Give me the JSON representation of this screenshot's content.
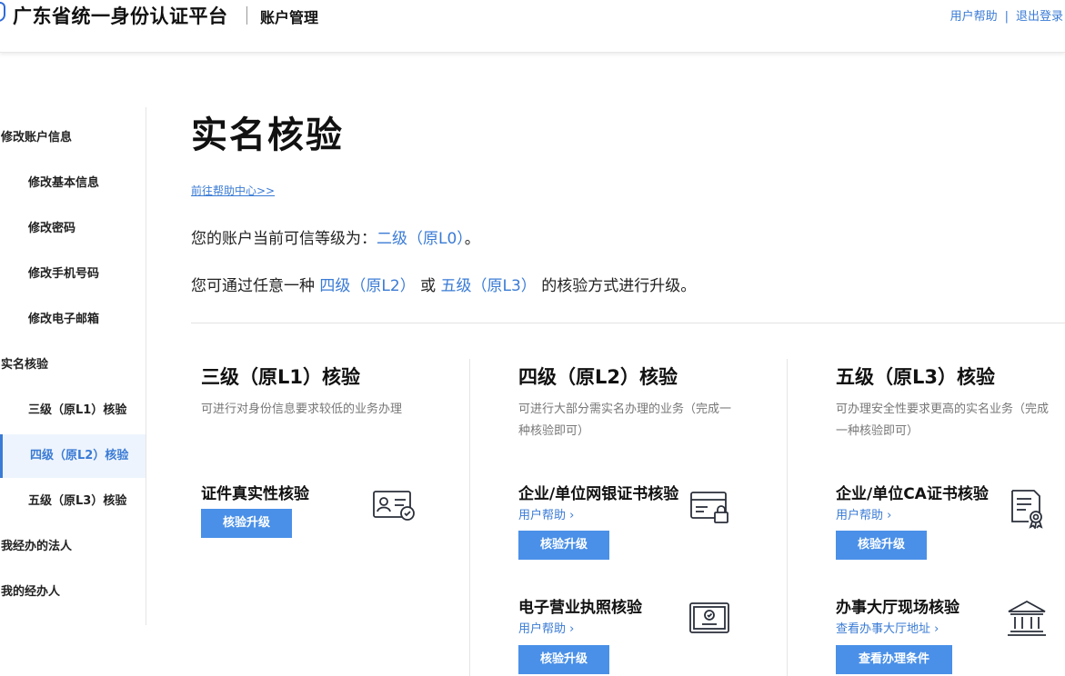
{
  "header": {
    "site_title": "广东省统一身份认证平台",
    "section_title": "账户管理",
    "help_link": "用户帮助",
    "separator": "|",
    "logout_link": "退出登录"
  },
  "sidebar": {
    "items": [
      {
        "label": "修改账户信息"
      },
      {
        "label": "修改基本信息"
      },
      {
        "label": "修改密码"
      },
      {
        "label": "修改手机号码"
      },
      {
        "label": "修改电子邮箱"
      },
      {
        "label": "实名核验"
      },
      {
        "label": "三级（原L1）核验"
      },
      {
        "label": "四级（原L2）核验"
      },
      {
        "label": "五级（原L3）核验"
      },
      {
        "label": "我经办的法人"
      },
      {
        "label": "我的经办人"
      }
    ]
  },
  "main": {
    "title": "实名核验",
    "help_center_link": "前往帮助中心>>",
    "level_prefix": "您的账户当前可信等级为：",
    "level_value": "二级（原L0）",
    "level_suffix": "。",
    "upgrade_prefix": "您可通过任意一种 ",
    "upgrade_level4": "四级（原L2）",
    "upgrade_or": " 或 ",
    "upgrade_level5": "五级（原L3）",
    "upgrade_suffix": " 的核验方式进行升级。"
  },
  "cards": [
    {
      "title": "三级（原L1）核验",
      "desc": "可进行对身份信息要求较低的业务办理",
      "methods": [
        {
          "name": "证件真实性核验",
          "help": "",
          "button": "核验升级",
          "icon": "id-card-icon"
        }
      ]
    },
    {
      "title": "四级（原L2）核验",
      "desc": "可进行大部分需实名办理的业务（完成一种核验即可）",
      "methods": [
        {
          "name": "企业/单位网银证书核验",
          "help": "用户帮助 ›",
          "button": "核验升级",
          "icon": "bank-card-lock-icon"
        },
        {
          "name": "电子营业执照核验",
          "help": "用户帮助 ›",
          "button": "核验升级",
          "icon": "business-license-icon"
        }
      ]
    },
    {
      "title": "五级（原L3）核验",
      "desc": "可办理安全性要求更高的实名业务（完成一种核验即可）",
      "methods": [
        {
          "name": "企业/单位CA证书核验",
          "help": "用户帮助 ›",
          "button": "核验升级",
          "icon": "certificate-icon"
        },
        {
          "name": "办事大厅现场核验",
          "help": "查看办事大厅地址 ›",
          "button": "查看办理条件",
          "icon": "government-hall-icon"
        }
      ]
    }
  ],
  "colors": {
    "accent": "#3a7bd5",
    "button": "#4a90e8",
    "active_bg": "#eef4fd"
  }
}
